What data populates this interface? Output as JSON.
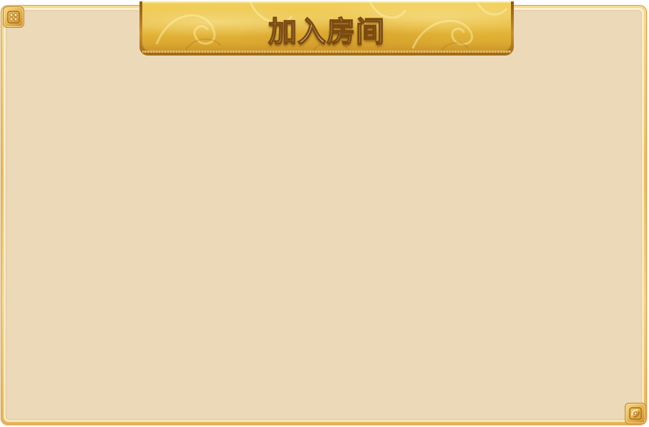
{
  "dialog": {
    "title": "加入房间"
  },
  "icons": {
    "top_left_corner": "corner-ornament-icon",
    "bottom_right_corner": "corner-ornament-icon"
  },
  "colors": {
    "panel_background": "#ecd9b8",
    "frame_gold": "#e9bc5c",
    "banner_gold": "#e8bc3f",
    "title_text": "#fff6dc"
  }
}
